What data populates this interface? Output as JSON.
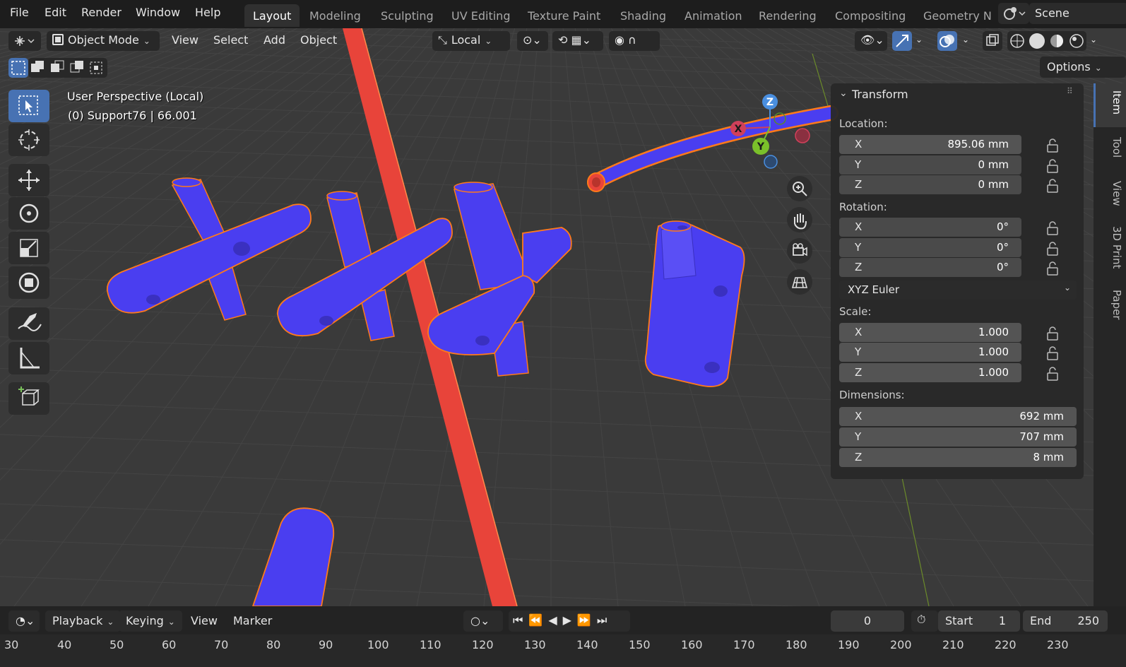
{
  "menu": [
    "File",
    "Edit",
    "Render",
    "Window",
    "Help"
  ],
  "workspaces": [
    "Layout",
    "Modeling",
    "Sculpting",
    "UV Editing",
    "Texture Paint",
    "Shading",
    "Animation",
    "Rendering",
    "Compositing",
    "Geometry N"
  ],
  "active_workspace": "Layout",
  "scene": "Scene",
  "viewport_header": {
    "mode": "Object Mode",
    "menus": [
      "View",
      "Select",
      "Add",
      "Object"
    ],
    "orientation": "Local",
    "options": "Options"
  },
  "overlay": {
    "perspective": "User Perspective (Local)",
    "object_info": "(0) Support76 | 66.001"
  },
  "gizmo": {
    "x": "X",
    "y": "Y",
    "z": "Z"
  },
  "transform_panel": {
    "title": "Transform",
    "location_label": "Location:",
    "location": [
      {
        "axis": "X",
        "value": "895.06 mm"
      },
      {
        "axis": "Y",
        "value": "0 mm"
      },
      {
        "axis": "Z",
        "value": "0 mm"
      }
    ],
    "rotation_label": "Rotation:",
    "rotation": [
      {
        "axis": "X",
        "value": "0°"
      },
      {
        "axis": "Y",
        "value": "0°"
      },
      {
        "axis": "Z",
        "value": "0°"
      }
    ],
    "rotation_mode": "XYZ Euler",
    "scale_label": "Scale:",
    "scale": [
      {
        "axis": "X",
        "value": "1.000"
      },
      {
        "axis": "Y",
        "value": "1.000"
      },
      {
        "axis": "Z",
        "value": "1.000"
      }
    ],
    "dimensions_label": "Dimensions:",
    "dimensions": [
      {
        "axis": "X",
        "value": "692 mm"
      },
      {
        "axis": "Y",
        "value": "707 mm"
      },
      {
        "axis": "Z",
        "value": "8 mm"
      }
    ]
  },
  "side_tabs": [
    "Item",
    "Tool",
    "View",
    "3D Print",
    "Paper"
  ],
  "timeline": {
    "menus": [
      "Playback",
      "Keying",
      "View",
      "Marker"
    ],
    "current_frame": "0",
    "start_label": "Start",
    "start": "1",
    "end_label": "End",
    "end": "250",
    "ticks": [
      "30",
      "40",
      "50",
      "60",
      "70",
      "80",
      "90",
      "100",
      "110",
      "120",
      "130",
      "140",
      "150",
      "160",
      "170",
      "180",
      "190",
      "200",
      "210",
      "220",
      "230"
    ]
  },
  "colors": {
    "accent": "#4772b3",
    "selected_mesh": "#4a3ef0",
    "active_outline": "#ff7a1a",
    "red_object": "#e8443a"
  }
}
